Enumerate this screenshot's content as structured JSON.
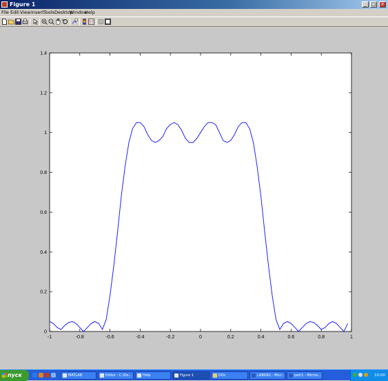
{
  "window": {
    "title": "Figure 1",
    "controls": {
      "minimize": "_",
      "maximize": "□",
      "close": "×"
    }
  },
  "menu": [
    "File",
    "Edit",
    "View",
    "Insert",
    "Tools",
    "Desktop",
    "Window",
    "Help"
  ],
  "toolbar": [
    "new-file-icon",
    "open-folder-icon",
    "save-icon",
    "print-icon",
    "select-arrow-icon",
    "zoom-in-icon",
    "zoom-out-icon",
    "pan-hand-icon",
    "rotate-3d-icon",
    "data-cursor-icon",
    "insert-colorbar-icon",
    "insert-legend-icon",
    "hide-plot-tools-icon",
    "show-plot-tools-icon"
  ],
  "chart_data": {
    "type": "line",
    "title": "",
    "xlabel": "",
    "ylabel": "",
    "xlim": [
      -1,
      1
    ],
    "ylim": [
      0,
      1.4
    ],
    "xticks": [
      "-1",
      "-0.8",
      "-0.6",
      "-0.4",
      "-0.2",
      "0",
      "0.2",
      "0.4",
      "0.6",
      "0.8",
      "1"
    ],
    "yticks": [
      "0",
      "0.2",
      "0.4",
      "0.6",
      "0.8",
      "1",
      "1.2",
      "1.4"
    ],
    "grid": false,
    "line_color": "#2020ff",
    "series": [
      {
        "x": [
          -1,
          -0.975,
          -0.95,
          -0.925,
          -0.9,
          -0.875,
          -0.85,
          -0.825,
          -0.8,
          -0.775,
          -0.75,
          -0.725,
          -0.7,
          -0.675,
          -0.65,
          -0.625,
          -0.6,
          -0.575,
          -0.55,
          -0.525,
          -0.5,
          -0.475,
          -0.45,
          -0.425,
          -0.4,
          -0.375,
          -0.35,
          -0.325,
          -0.3,
          -0.275,
          -0.25,
          -0.225,
          -0.2,
          -0.175,
          -0.15,
          -0.125,
          -0.1,
          -0.075,
          -0.05,
          -0.025,
          0,
          0.025,
          0.05,
          0.075,
          0.1,
          0.125,
          0.15,
          0.175,
          0.2,
          0.225,
          0.25,
          0.275,
          0.3,
          0.325,
          0.35,
          0.375,
          0.4,
          0.425,
          0.45,
          0.475,
          0.5,
          0.525,
          0.55,
          0.575,
          0.6,
          0.625,
          0.65,
          0.675,
          0.7,
          0.725,
          0.75,
          0.775,
          0.8,
          0.825,
          0.85,
          0.875,
          0.9,
          0.925,
          0.95,
          0.975
        ],
        "y": [
          0.05,
          0.04,
          0.02,
          0.01,
          0.03,
          0.045,
          0.05,
          0.04,
          0.02,
          0.0,
          0.02,
          0.04,
          0.05,
          0.04,
          0.01,
          0.06,
          0.18,
          0.33,
          0.5,
          0.68,
          0.83,
          0.95,
          1.02,
          1.05,
          1.05,
          1.03,
          0.99,
          0.96,
          0.95,
          0.96,
          0.98,
          1.02,
          1.04,
          1.05,
          1.04,
          1.01,
          0.97,
          0.95,
          0.95,
          0.97,
          1.0,
          1.03,
          1.05,
          1.05,
          1.04,
          1.0,
          0.96,
          0.95,
          0.96,
          0.99,
          1.03,
          1.05,
          1.05,
          1.02,
          0.95,
          0.83,
          0.68,
          0.5,
          0.33,
          0.18,
          0.06,
          0.01,
          0.04,
          0.05,
          0.04,
          0.02,
          0.0,
          0.02,
          0.04,
          0.05,
          0.045,
          0.03,
          0.01,
          0.02,
          0.04,
          0.05,
          0.04,
          0.02,
          0.0,
          0.04
        ]
      }
    ]
  },
  "taskbar": {
    "start_label": "пуск",
    "quick_launch": [
      "ie-icon",
      "media-player-icon",
      "outlook-icon",
      "desktop-icon"
    ],
    "tasks": [
      {
        "label": "MATLAB",
        "active": false
      },
      {
        "label": "Editor - C:\\Do...",
        "active": false
      },
      {
        "label": "Help",
        "active": false
      },
      {
        "label": "Figure 1",
        "active": true
      },
      {
        "label": "DOc",
        "active": false
      },
      {
        "label": "LABOR1 - Micr...",
        "active": false
      },
      {
        "label": "petr1 - Micros...",
        "active": false
      }
    ],
    "clock": "10:00"
  }
}
